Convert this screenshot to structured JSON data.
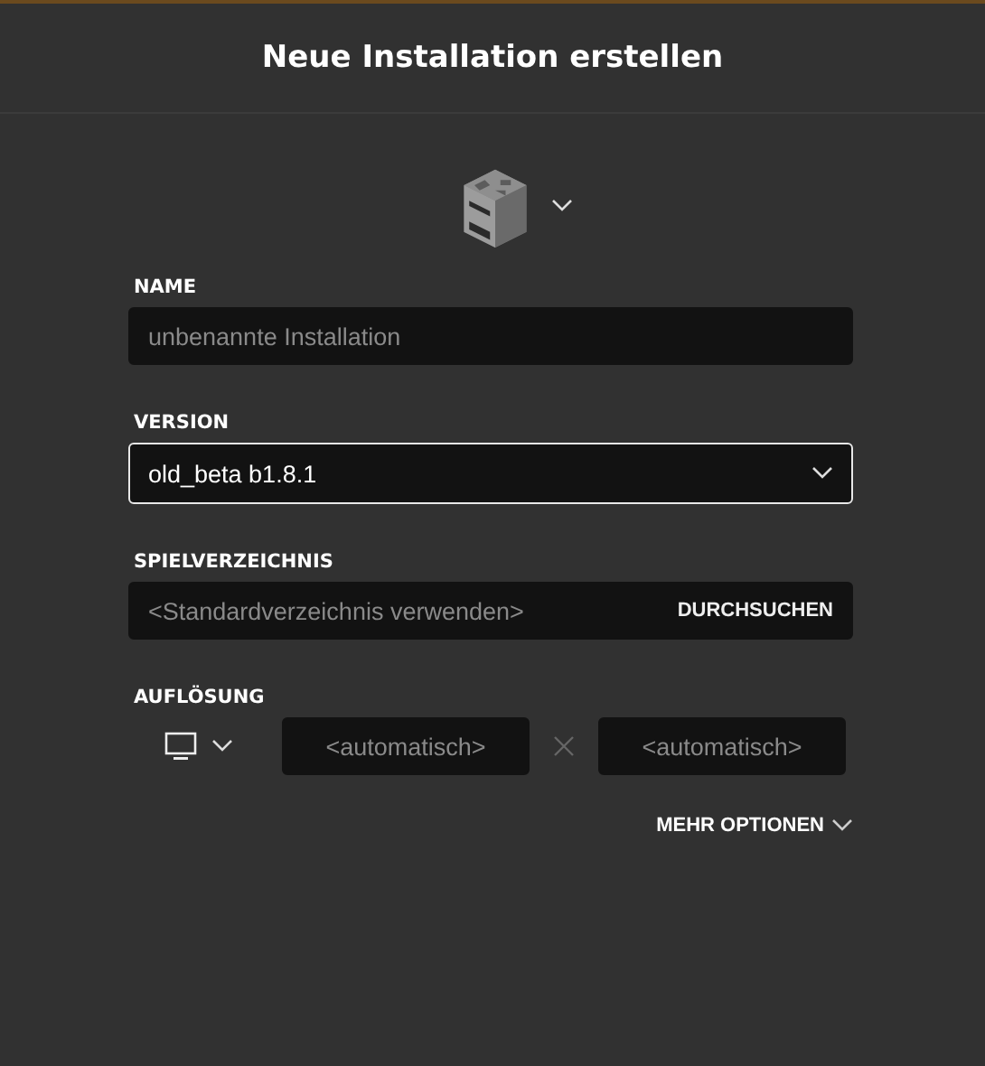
{
  "dialog": {
    "title": "Neue Installation erstellen"
  },
  "fields": [
    {
      "kind": "text",
      "label": "NAME",
      "placeholder": "unbenannte Installation"
    },
    {
      "kind": "select",
      "label": "VERSION",
      "value": "old_beta b1.8.1",
      "focused": true
    },
    {
      "kind": "browse",
      "label": "SPIELVERZEICHNIS",
      "placeholder": "<Standardverzeichnis verwenden>",
      "button": "DURCHSUCHEN"
    },
    {
      "kind": "resolution",
      "label": "AUFLÖSUNG",
      "width_placeholder": "<automatisch>",
      "height_placeholder": "<automatisch>"
    }
  ],
  "more_options": "MEHR OPTIONEN"
}
